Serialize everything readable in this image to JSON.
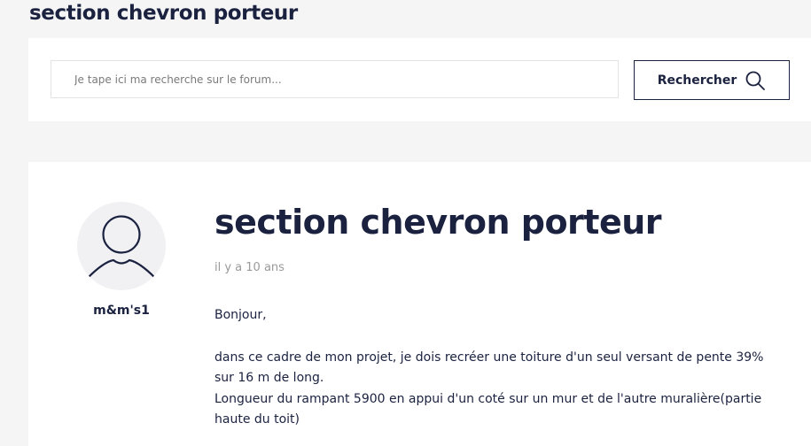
{
  "page": {
    "title": "section chevron porteur"
  },
  "search": {
    "placeholder": "Je tape ici ma recherche sur le forum...",
    "value": "",
    "button_label": "Rechercher",
    "button_icon": "search-icon"
  },
  "post": {
    "author": {
      "name": "m&m's1",
      "avatar_icon": "user-avatar-icon"
    },
    "title": "section chevron porteur",
    "date": "il y a 10 ans",
    "body": {
      "greeting": "Bonjour,",
      "line1": "dans ce cadre de mon projet, je dois recréer une toiture d'un seul versant de pente 39% sur 16 m de long.",
      "line2": "Longueur du rampant 5900 en appui d'un coté sur un mur et de l'autre muralière(partie haute du toit)"
    }
  },
  "colors": {
    "navy": "#1b2240",
    "page_bg": "#f5f5f5",
    "muted": "#9a9a9a",
    "avatar_bg": "#f1f1f3"
  }
}
